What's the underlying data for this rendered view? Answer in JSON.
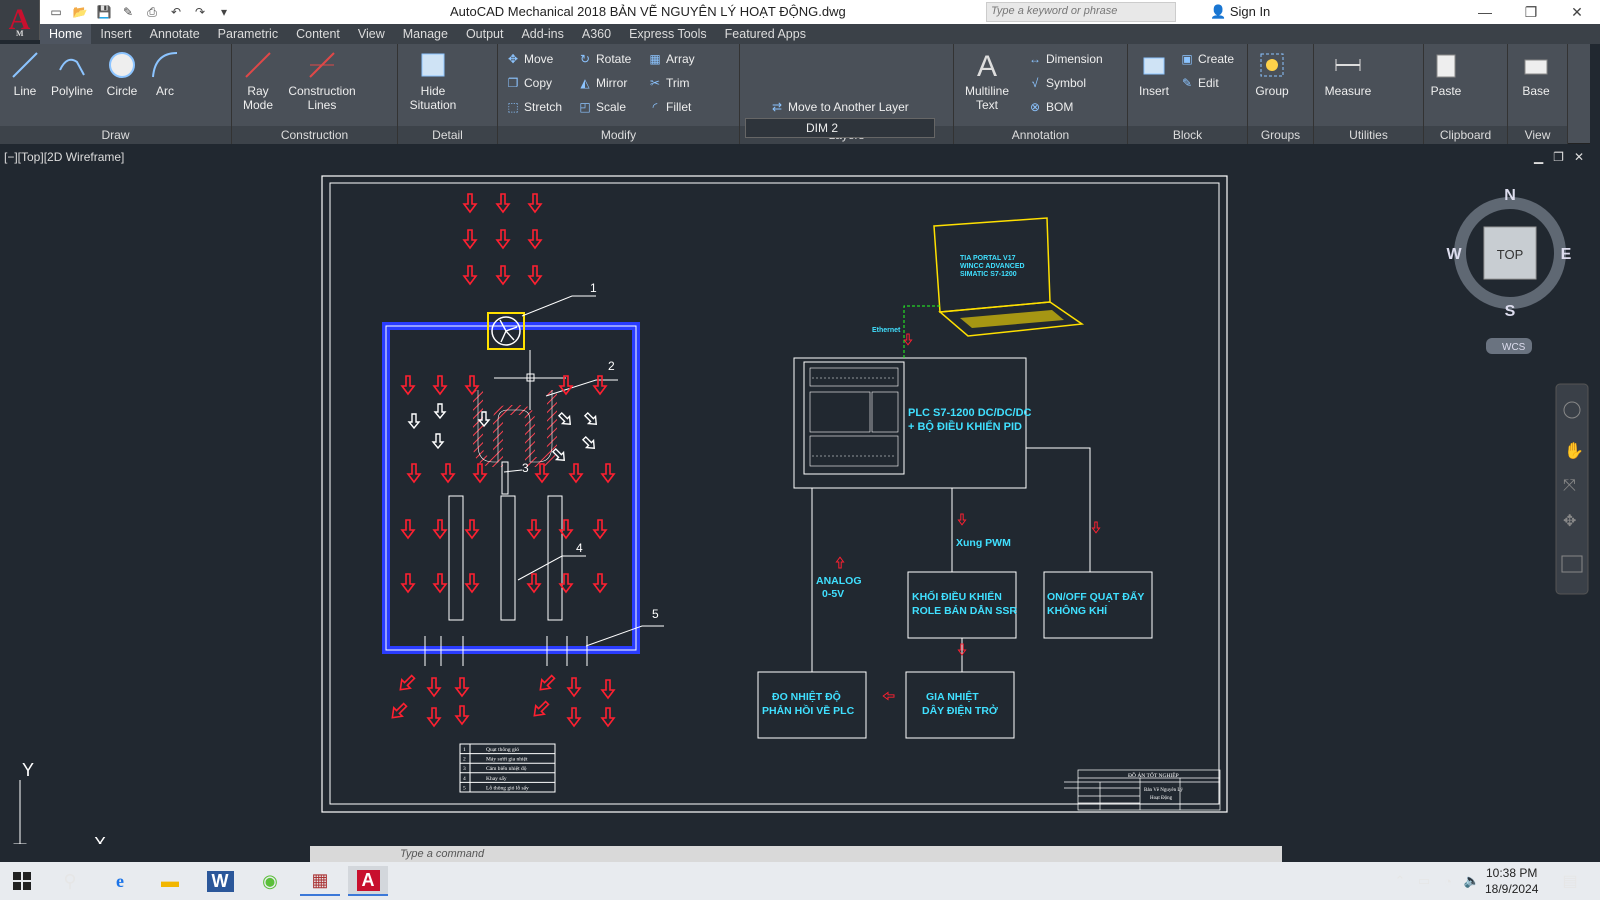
{
  "app": {
    "logo_letter": "A",
    "logo_sub": "M",
    "title": "AutoCAD Mechanical 2018    BẢN VẼ NGUYÊN LÝ HOẠT ĐỘNG.dwg",
    "search_placeholder": "Type a keyword or phrase",
    "sign_in": "Sign In"
  },
  "tabs": [
    "Home",
    "Insert",
    "Annotate",
    "Parametric",
    "Content",
    "View",
    "Manage",
    "Output",
    "Add-ins",
    "A360",
    "Express Tools",
    "Featured Apps"
  ],
  "ribbon": {
    "draw": {
      "title": "Draw",
      "line": "Line",
      "polyline": "Polyline",
      "circle": "Circle",
      "arc": "Arc"
    },
    "construction": {
      "title": "Construction",
      "ray": "Ray Mode",
      "lines": "Construction Lines"
    },
    "detail": {
      "title": "Detail",
      "hide": "Hide Situation"
    },
    "modify": {
      "title": "Modify",
      "move": "Move",
      "rotate": "Rotate",
      "array": "Array",
      "copy": "Copy",
      "mirror": "Mirror",
      "trim": "Trim",
      "stretch": "Stretch",
      "scale": "Scale",
      "fillet": "Fillet"
    },
    "layers": {
      "title": "Layers",
      "current": "DIM 2",
      "move_layer": "Move to Another Layer"
    },
    "annotation": {
      "title": "Annotation",
      "mtext": "Multiline Text",
      "dimension": "Dimension",
      "symbol": "Symbol",
      "bom": "BOM"
    },
    "block": {
      "title": "Block",
      "insert": "Insert",
      "create": "Create",
      "edit": "Edit"
    },
    "groups": {
      "title": "Groups",
      "group": "Group"
    },
    "utilities": {
      "title": "Utilities",
      "measure": "Measure"
    },
    "clipboard": {
      "title": "Clipboard",
      "paste": "Paste"
    },
    "view": {
      "title": "View",
      "base": "Base"
    }
  },
  "viewport": {
    "label": "[−][Top][2D Wireframe]"
  },
  "viewcube": {
    "n": "N",
    "s": "S",
    "e": "E",
    "w": "W",
    "top": "TOP",
    "wcs": "WCS"
  },
  "ucs": {
    "y": "Y",
    "x": "X"
  },
  "drawing": {
    "callouts": [
      "1",
      "2",
      "3",
      "4",
      "5"
    ],
    "plc": "PLC S7-1200 DC/DC/DC",
    "plc2": "+ BỘ ĐIỀU KHIỂN PID",
    "pwm": "Xung PWM",
    "analog1": "ANALOG",
    "analog2": "0-5V",
    "ssr1": "KHỐI ĐIỀU KHIỂN",
    "ssr2": "ROLE BÁN DẪN SSR",
    "fan1": "ON/OFF QUẠT ĐẨY",
    "fan2": "KHÔNG KHÍ",
    "temp1": "ĐO NHIỆT ĐỘ",
    "temp2": "PHẢN HỒI VỀ PLC",
    "heat1": "GIA NHIỆT",
    "heat2": "DÂY ĐIỆN TRỞ",
    "ethernet": "Ethernet",
    "laptop1": "TIA PORTAL V17",
    "laptop2": "WINCC ADVANCED",
    "laptop3": "SIMATIC S7-1200",
    "legend": [
      {
        "no": "1",
        "name": "Quạt thông gió"
      },
      {
        "no": "2",
        "name": "Máy sưởi gia nhiệt"
      },
      {
        "no": "3",
        "name": "Cảm biến nhiệt độ"
      },
      {
        "no": "4",
        "name": "Khay sấy"
      },
      {
        "no": "5",
        "name": "Lỗ thông gió lỗ sấy"
      }
    ],
    "titleblock": {
      "head": "ĐỒ ÁN TỐT NGHIỆP",
      "name1": "Bản Vẽ Nguyên Lý",
      "name2": "Hoạt Động"
    }
  },
  "command": {
    "placeholder": "Type a command"
  },
  "taskbar": {
    "time": "10:38 PM",
    "date": "18/9/2024"
  }
}
